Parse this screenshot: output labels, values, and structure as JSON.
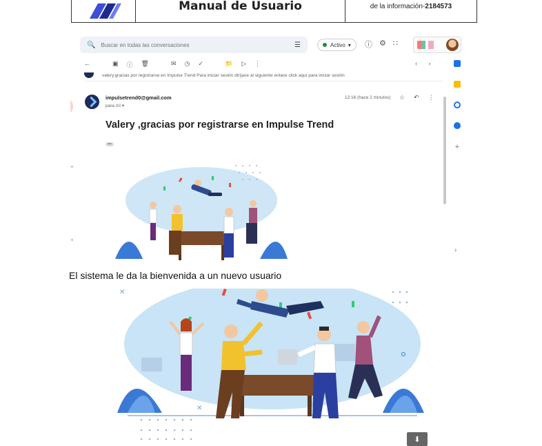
{
  "header": {
    "title": "Manual de Usuario",
    "info_prefix": "de la información-",
    "info_code": "2184573"
  },
  "gmail": {
    "search_placeholder": "Buscar en todas las conversaciones",
    "status": "Activo",
    "preview_text": "valery.gracias por registrarse en Impulse Trend Para iniciar sesión diríjase al siguiente enlace click aquí para iniciar sesión",
    "sender": "impulsetrend0@gmail.com",
    "to": "para mí",
    "time": "12:16 (hace 2 minutos)",
    "subject": "Valery ,gracias por registrarse en Impulse Trend",
    "ellipsis": "•••"
  },
  "caption": "El sistema le da la bienvenida a un nuevo usuario",
  "icons": {
    "search": "search-icon",
    "tune": "tune-icon",
    "help": "help-icon",
    "settings": "gear-icon",
    "apps": "apps-grid-icon",
    "download": "download-icon"
  },
  "colors": {
    "accent": "#1a73e8",
    "status_green": "#1e8e3e",
    "illus_blue": "#c8e4f6",
    "illus_yellow": "#f2c12e",
    "illus_desk": "#7a4a2b"
  }
}
